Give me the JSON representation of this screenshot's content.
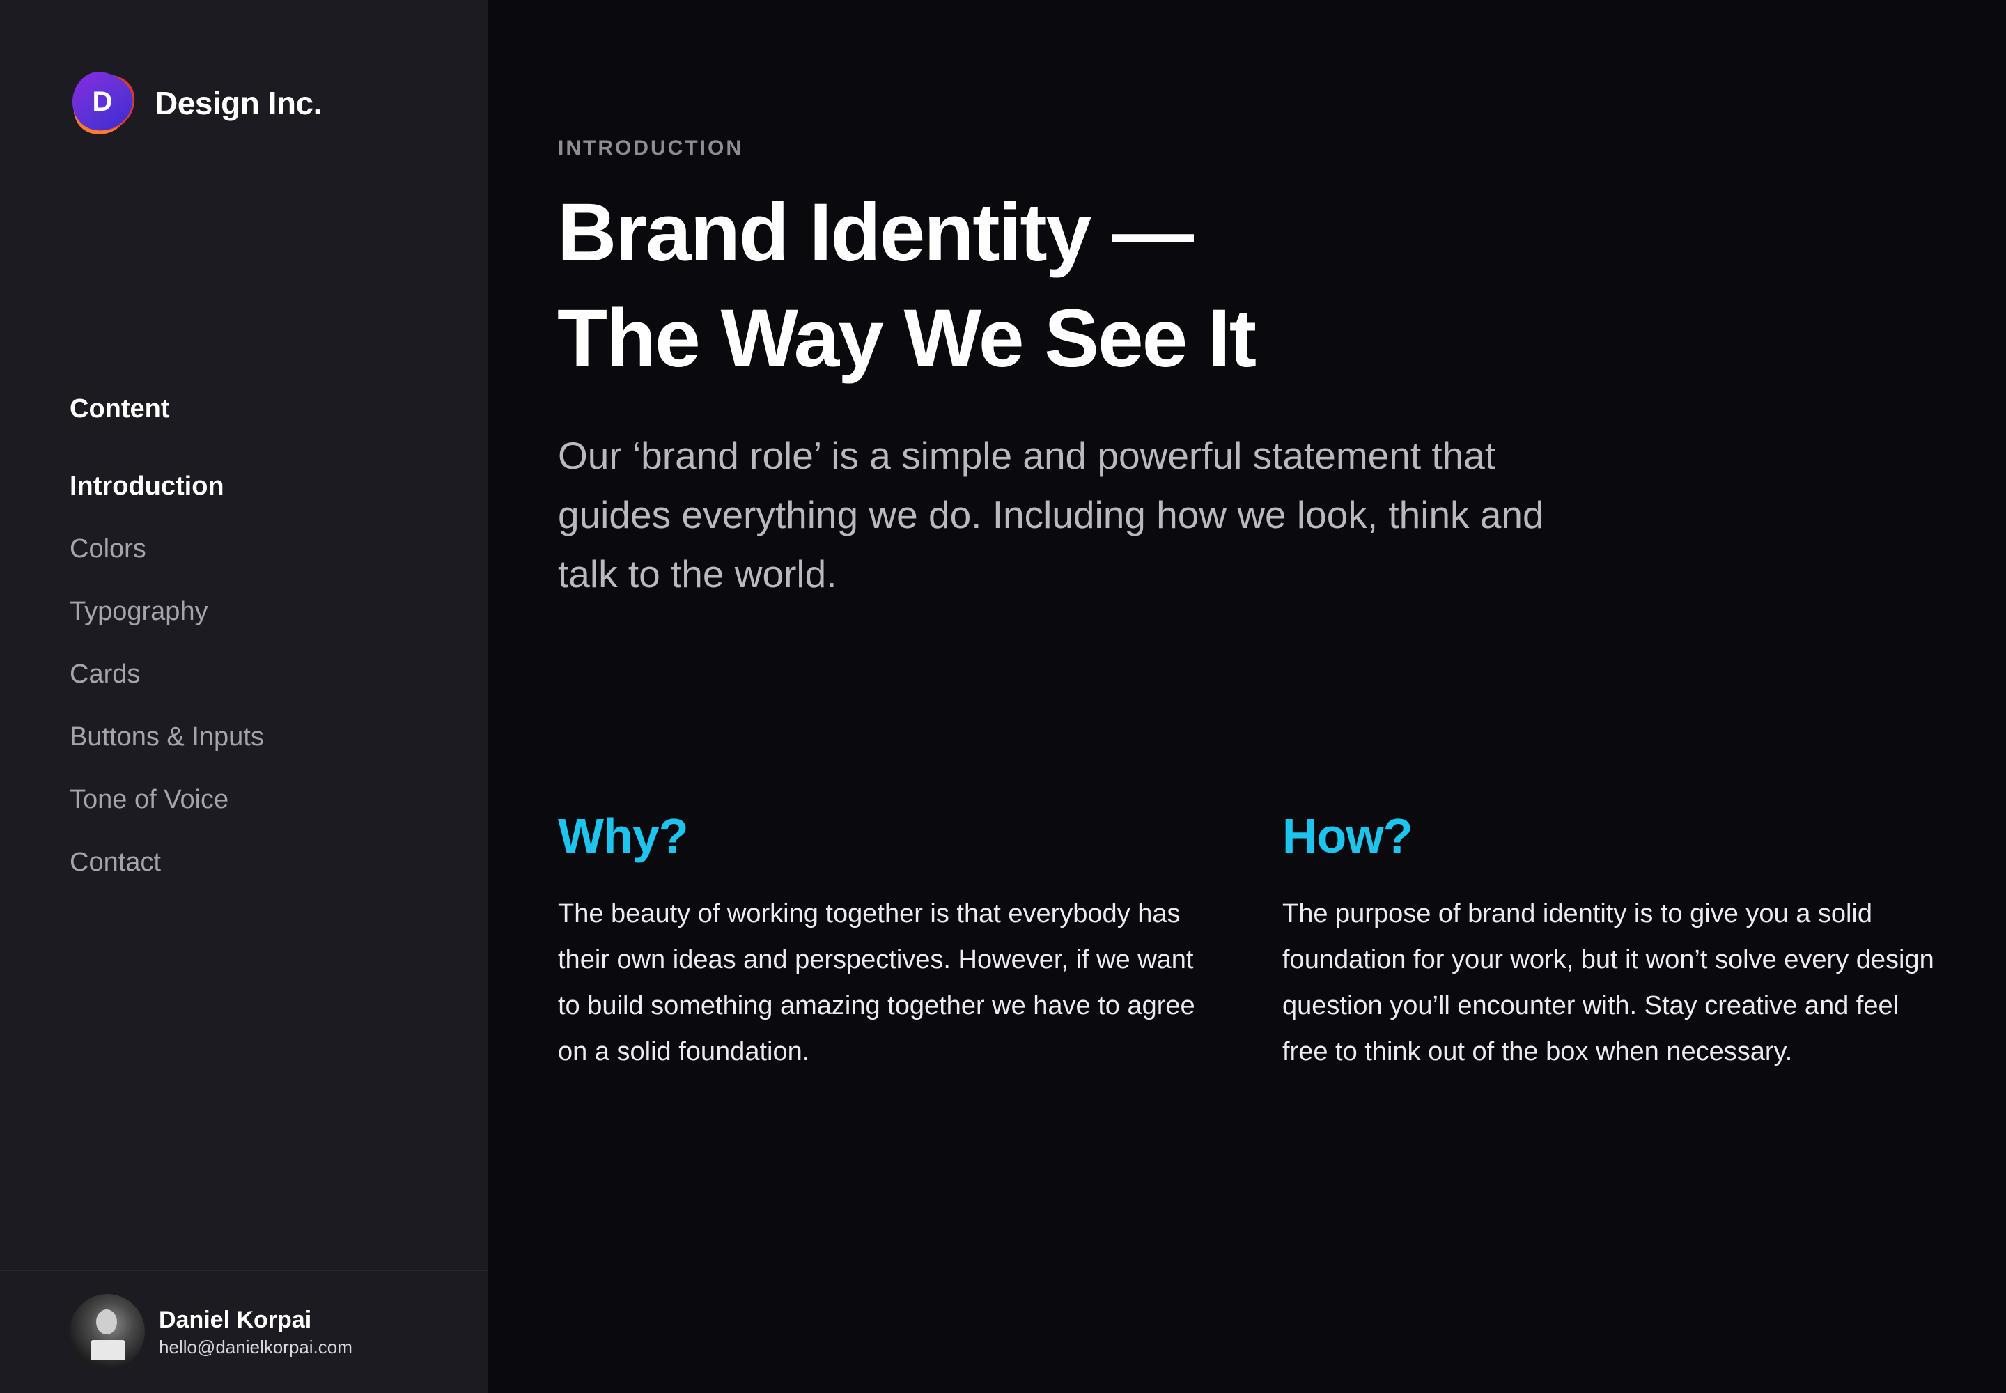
{
  "sidebar": {
    "brand": {
      "logo_letter": "D",
      "name": "Design Inc."
    },
    "nav_heading": "Content",
    "items": [
      {
        "label": "Introduction",
        "active": true
      },
      {
        "label": "Colors",
        "active": false
      },
      {
        "label": "Typography",
        "active": false
      },
      {
        "label": "Cards",
        "active": false
      },
      {
        "label": "Buttons & Inputs",
        "active": false
      },
      {
        "label": "Tone of Voice",
        "active": false
      },
      {
        "label": "Contact",
        "active": false
      }
    ],
    "profile": {
      "name": "Daniel Korpai",
      "email": "hello@danielkorpai.com"
    }
  },
  "main": {
    "eyebrow": "INTRODUCTION",
    "title_line1": "Brand Identity —",
    "title_line2": "The Way We See It",
    "lead": "Our ‘brand role’ is a simple and powerful statement that guides everything we do. Including how we look, think and talk to the world.",
    "why": {
      "heading": "Why?",
      "body": "The beauty of working together is that everybody has their own ideas and perspectives. However, if we want to build something amazing together we have to agree on a solid foundation."
    },
    "how": {
      "heading": "How?",
      "body": "The purpose of brand identity is to give you a solid foundation for your work, but it won’t solve every design question you’ll encounter with. Stay creative and feel free to think out of the box when necessary."
    }
  },
  "colors": {
    "background": "#0a0a0e",
    "sidebar": "#1b1b21",
    "accent": "#1cc4ee",
    "logo_purple": "#5b32d6",
    "logo_orange": "#ff7a29"
  }
}
